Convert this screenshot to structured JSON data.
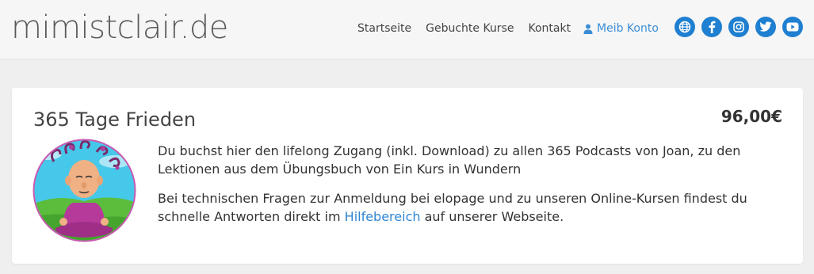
{
  "header": {
    "logo": "mimistclair.de",
    "nav": [
      "Startseite",
      "Gebuchte Kurse",
      "Kontakt"
    ],
    "account_label": "Meib Konto",
    "socials": [
      "globe-icon",
      "facebook-icon",
      "instagram-icon",
      "twitter-icon",
      "youtube-icon"
    ],
    "accent_color": "#1f7fd1"
  },
  "product": {
    "title": "365 Tage Frieden",
    "price": "96,00€",
    "paragraph1": "Du buchst hier den lifelong Zugang (inkl. Download) zu allen 365 Podcasts von Joan, zu den Lektionen aus dem Übungsbuch von Ein Kurs in Wundern",
    "paragraph2_before": "Bei technischen Fragen zur Anmeldung bei elopage und zu unseren Online-Kursen findest du schnelle Antworten direkt im ",
    "paragraph2_link": "Hilfebereich",
    "paragraph2_after": " auf unserer Webseite."
  }
}
